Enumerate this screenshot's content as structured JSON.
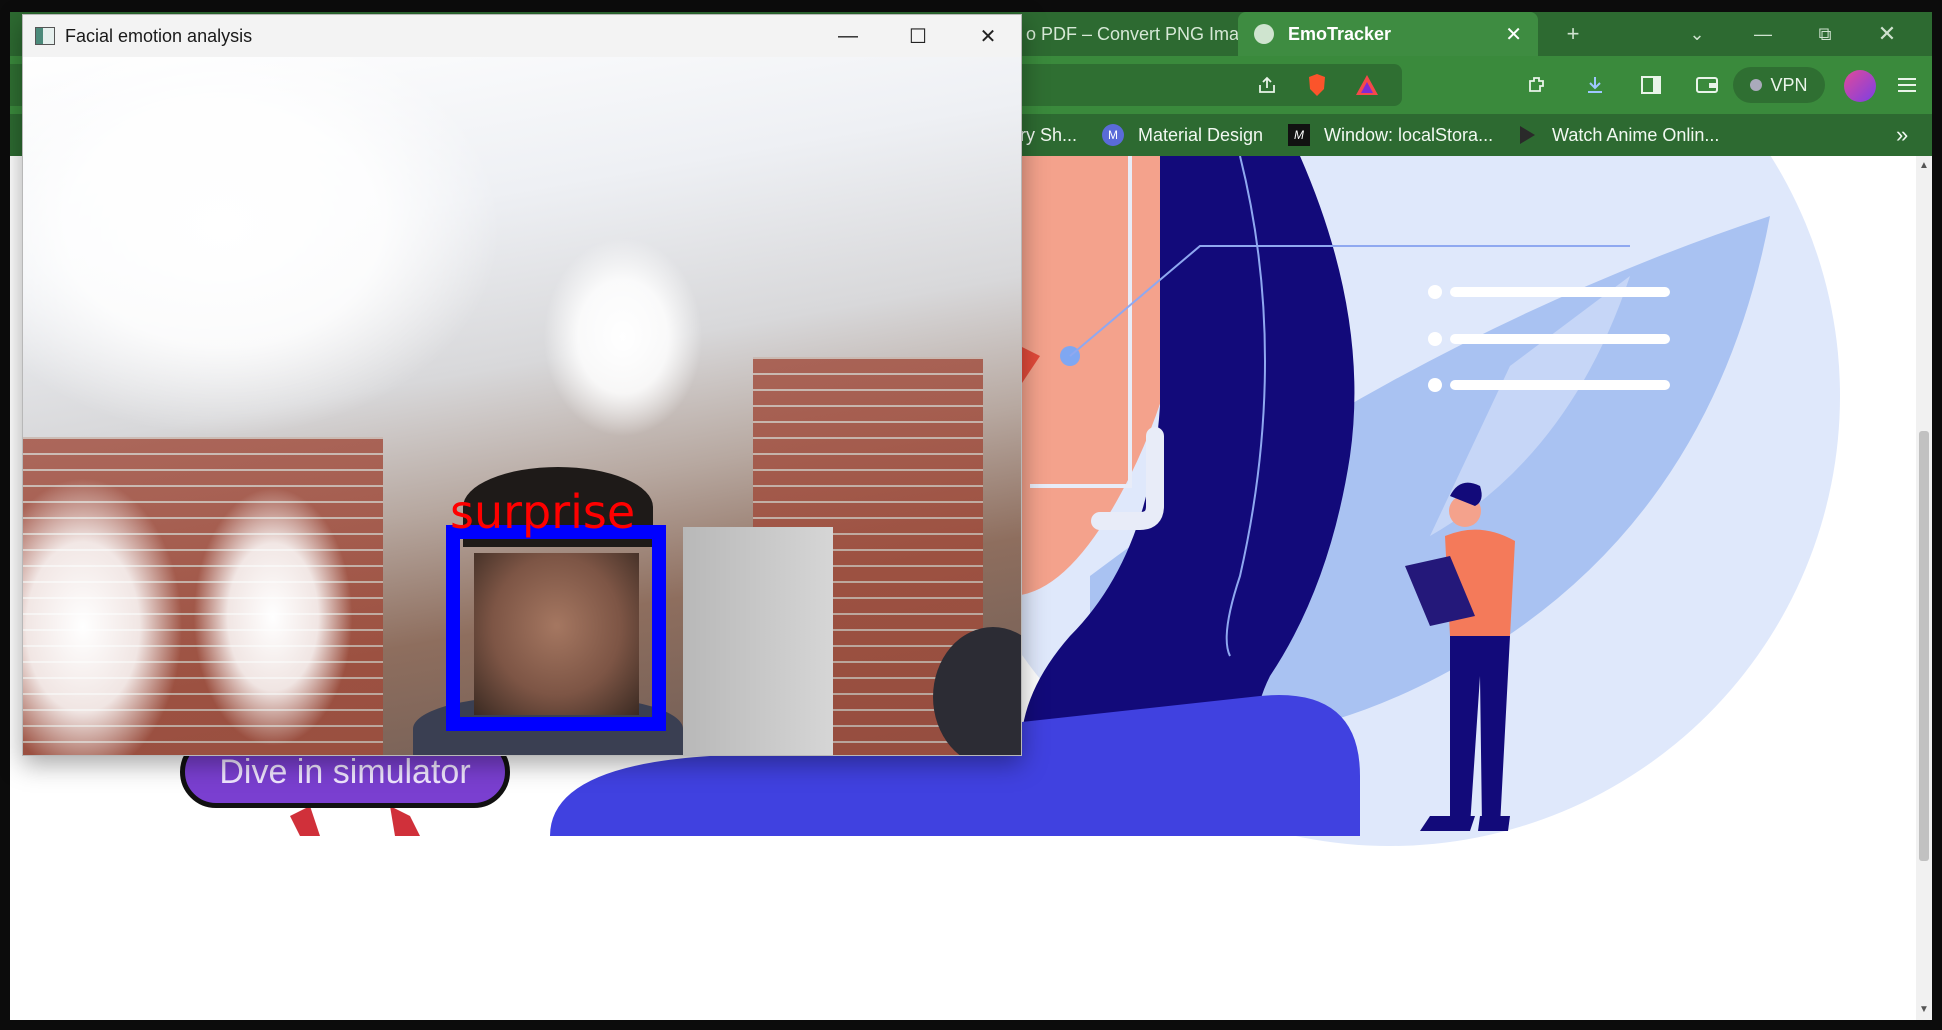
{
  "browser": {
    "tabs": [
      {
        "label": "o PDF – Convert PNG Ima",
        "active": false
      },
      {
        "label": "EmoTracker",
        "active": true,
        "close": "✕"
      }
    ],
    "new_tab": "+",
    "tab_menu": "⌄",
    "window_controls": {
      "minimize": "—",
      "restore": "⧉",
      "close": "✕"
    },
    "vpn_label": "VPN",
    "bookmarks": [
      {
        "label": "ery Sh...",
        "icon": "none"
      },
      {
        "label": "Material Design",
        "icon": "material-icon"
      },
      {
        "label": "Window: localStora...",
        "icon": "mdn-icon"
      },
      {
        "label": "Watch Anime Onlin...",
        "icon": "play-icon"
      }
    ],
    "bookmarks_more": "»"
  },
  "page": {
    "cta_button": "Dive in simulator"
  },
  "emotion_window": {
    "title": "Facial emotion analysis",
    "controls": {
      "minimize": "—",
      "maximize": "☐",
      "close": "✕"
    },
    "detected_emotion": "surprise",
    "box_color": "#0000ff",
    "label_color": "#ff0000"
  },
  "colors": {
    "tabbar": "#2d6a31",
    "toolbar": "#3a8a3c",
    "illustration_navy": "#120a7a",
    "illustration_blue": "#4041e0",
    "illustration_light": "#a9c2f2",
    "skin": "#f4a28c",
    "shirt": "#f47a5a"
  }
}
